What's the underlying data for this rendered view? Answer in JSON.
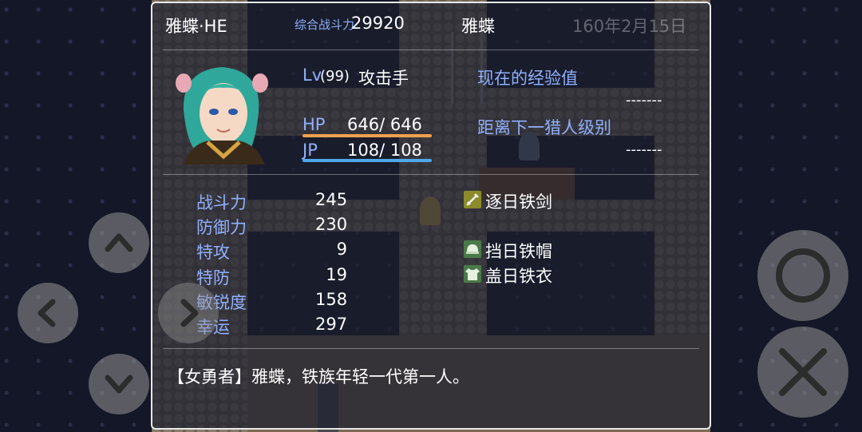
{
  "header": {
    "name": "雅蝶·HE",
    "power_label": "综合战斗力",
    "power_value": "29920",
    "nickname": "雅蝶",
    "date": "160年2月15日"
  },
  "status": {
    "lv_label": "Lv",
    "lv_value": "(99)",
    "class": "攻击手",
    "hp_label": "HP",
    "hp_value": "646/  646",
    "hp_fraction": 1.0,
    "jp_label": "JP",
    "jp_value": "108/  108",
    "jp_fraction": 1.0,
    "exp_label": "现在的经验值",
    "exp_value": "-------",
    "next_label": "距离下一猎人级别",
    "next_value": "-------"
  },
  "params": [
    {
      "label": "战斗力",
      "value": "245"
    },
    {
      "label": "防御力",
      "value": "230"
    },
    {
      "label": "特攻",
      "value": "9"
    },
    {
      "label": "特防",
      "value": "19"
    },
    {
      "label": "敏锐度",
      "value": "158"
    },
    {
      "label": "幸运",
      "value": "297"
    }
  ],
  "equipment": {
    "weapon": {
      "name": "逐日铁剑",
      "icon": "sword-icon"
    },
    "helmet": {
      "name": "挡日铁帽",
      "icon": "helmet-icon"
    },
    "armor": {
      "name": "盖日铁衣",
      "icon": "armor-icon"
    }
  },
  "profile": "【女勇者】雅蝶，铁族年轻一代第一人。",
  "colors": {
    "label": "#8fb0ff",
    "hp_bar": "#f0a050",
    "jp_bar": "#4fa8e8",
    "window_border": "#e8e8e8"
  },
  "controls": {
    "up": "chevron-up-icon",
    "down": "chevron-down-icon",
    "left": "chevron-left-icon",
    "right": "chevron-right-icon",
    "confirm": "circle-icon",
    "cancel": "x-icon"
  }
}
